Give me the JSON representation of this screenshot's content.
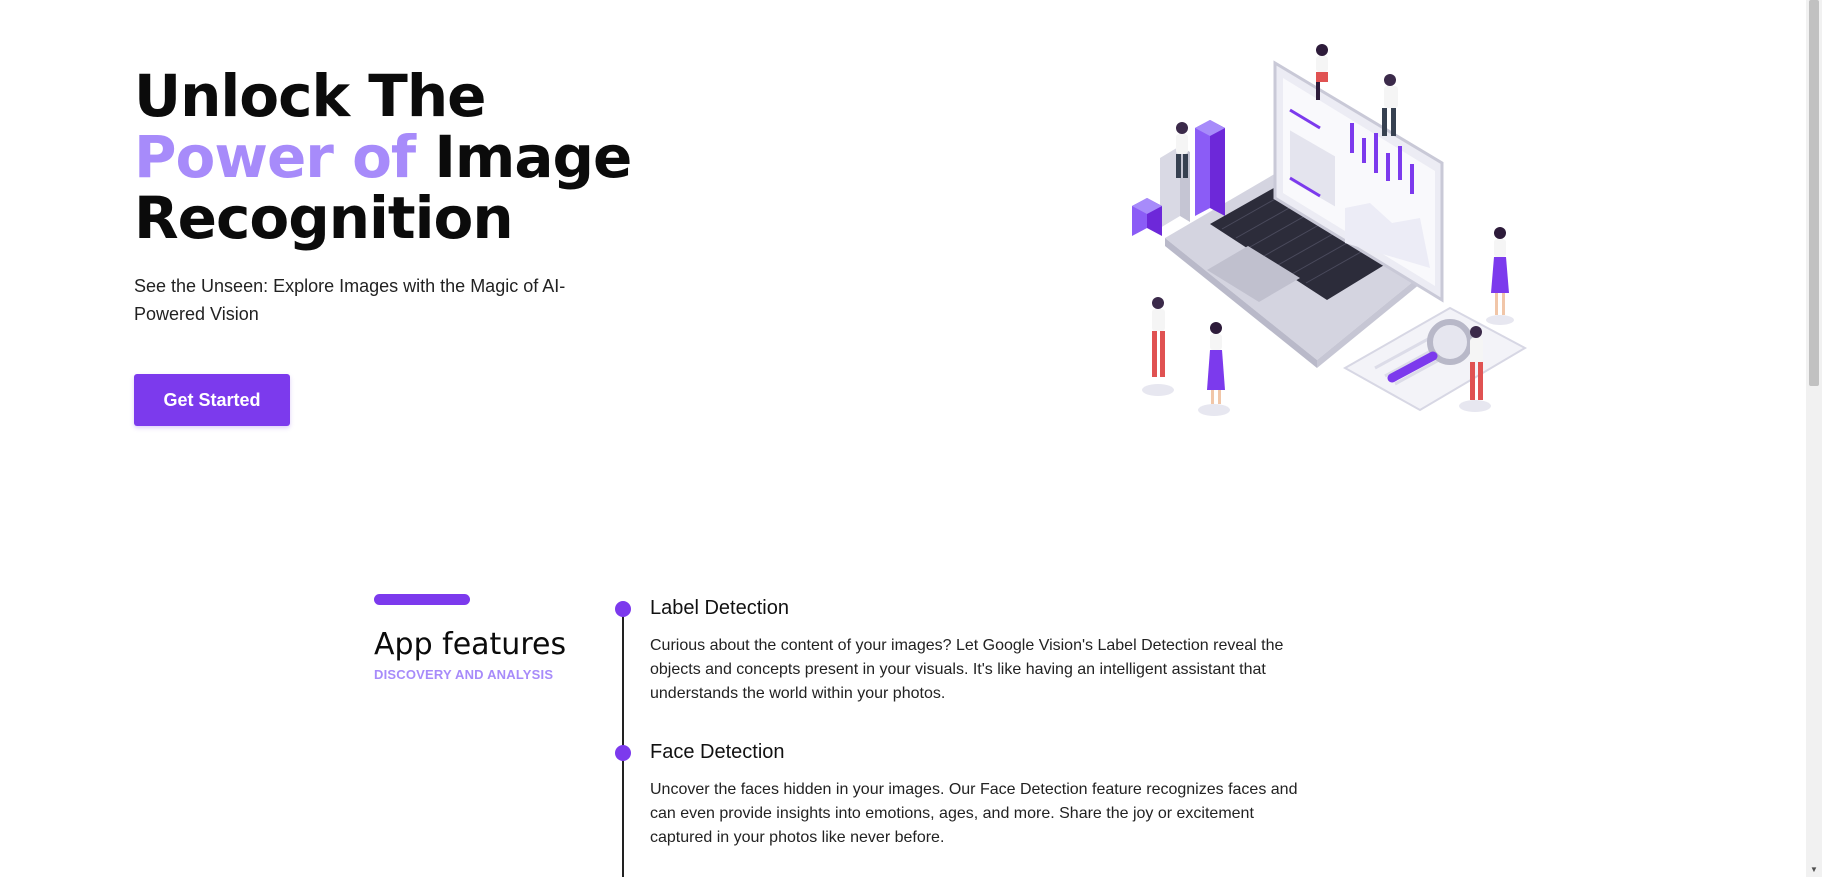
{
  "hero": {
    "title_line1": "Unlock The",
    "title_accent": "Power of",
    "title_line2_rest": " Image",
    "title_line3": "Recognition",
    "subtitle": "See the Unseen: Explore Images with the Magic of AI-Powered Vision",
    "cta_label": "Get Started"
  },
  "features": {
    "title": "App features",
    "subtitle": "DISCOVERY AND ANALYSIS",
    "items": [
      {
        "title": "Label Detection",
        "description": "Curious about the content of your images? Let Google Vision's Label Detection reveal the objects and concepts present in your visuals. It's like having an intelligent assistant that understands the world within your photos."
      },
      {
        "title": "Face Detection",
        "description": "Uncover the faces hidden in your images. Our Face Detection feature recognizes faces and can even provide insights into emotions, ages, and more. Share the joy or excitement captured in your photos like never before."
      }
    ]
  },
  "colors": {
    "accent": "#7c3aed",
    "accent_light": "#a78bfa",
    "text": "#0b0b0b"
  },
  "icons": {
    "scroll_up": "scroll-up-arrow-icon",
    "scroll_down": "scroll-down-arrow-icon"
  }
}
